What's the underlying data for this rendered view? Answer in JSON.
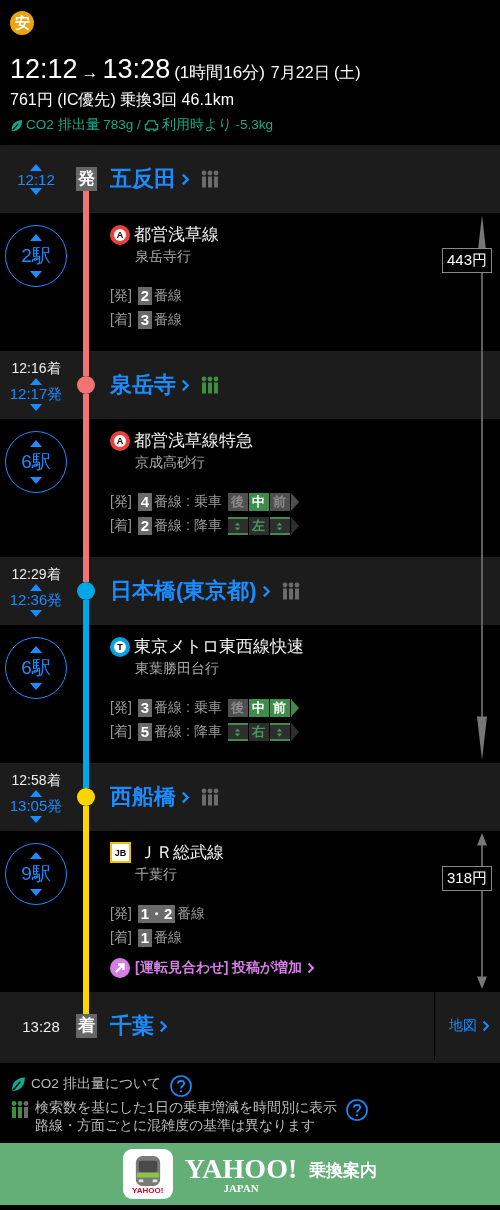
{
  "header": {
    "safety_badge": "安",
    "departure": "12:12",
    "arrow": "→",
    "arrival": "13:28",
    "duration": "(1時間16分)",
    "date": "7月22日 (土)",
    "summary": "761円 (IC優先) 乗換3回 46.1km",
    "co2": "CO2 排出量 783g /",
    "co2_compare": "利用時より -5.3kg"
  },
  "route": [
    {
      "kind": "station",
      "name": "五反田",
      "departure": "12:12",
      "mark": "発",
      "crowd": {
        "color": "#6b6b6b"
      }
    },
    {
      "kind": "leg",
      "color": "#f07474",
      "stops": "2駅",
      "badge": {
        "kind": "circle",
        "text": "A",
        "color": "#e8413c"
      },
      "line": "都営浅草線",
      "destination": "泉岳寺行",
      "fare": "443円",
      "platforms": [
        {
          "tag": "[発]",
          "track": "2",
          "suffix": "番線"
        },
        {
          "tag": "[着]",
          "track": "3",
          "suffix": "番線"
        }
      ]
    },
    {
      "kind": "station",
      "name": "泉岳寺",
      "arrival": "12:16着",
      "departure": "12:17発",
      "crowd": {
        "color": "#3e8e3e"
      }
    },
    {
      "kind": "leg",
      "color": "#f07474",
      "stops": "6駅",
      "badge": {
        "kind": "circle",
        "text": "A",
        "color": "#e8413c"
      },
      "line": "都営浅草線特急",
      "destination": "京成高砂行",
      "platforms": [
        {
          "tag": "[発]",
          "track": "4",
          "suffix": "番線 : 乗車",
          "cars": [
            {
              "label": "後",
              "selected": false
            },
            {
              "label": "中",
              "selected": true
            },
            {
              "label": "前",
              "selected": false
            }
          ]
        },
        {
          "tag": "[着]",
          "track": "2",
          "suffix": "番線 : 降車",
          "doors": [
            {
              "kind": "stairs"
            },
            {
              "kind": "text",
              "label": "左"
            },
            {
              "kind": "stairs"
            }
          ]
        }
      ]
    },
    {
      "kind": "station",
      "name": "日本橋(東京都)",
      "arrival": "12:29着",
      "departure": "12:36発",
      "crowd": {
        "color": "#6b6b6b"
      }
    },
    {
      "kind": "leg",
      "color": "#00a7e8",
      "stops": "6駅",
      "badge": {
        "kind": "circle",
        "text": "T",
        "color": "#0aa0e0"
      },
      "line": "東京メトロ東西線快速",
      "destination": "東葉勝田台行",
      "platforms": [
        {
          "tag": "[発]",
          "track": "3",
          "suffix": "番線 : 乗車",
          "cars": [
            {
              "label": "後",
              "selected": false
            },
            {
              "label": "中",
              "selected": true
            },
            {
              "label": "前",
              "selected": true
            }
          ]
        },
        {
          "tag": "[着]",
          "track": "5",
          "suffix": "番線 : 降車",
          "doors": [
            {
              "kind": "stairs"
            },
            {
              "kind": "text",
              "label": "右"
            },
            {
              "kind": "stairs"
            }
          ]
        }
      ]
    },
    {
      "kind": "station",
      "name": "西船橋",
      "arrival": "12:58着",
      "departure": "13:05発",
      "crowd": {
        "color": "#6b6b6b"
      }
    },
    {
      "kind": "leg",
      "color": "#ffd500",
      "stops": "9駅",
      "badge": {
        "kind": "square",
        "text": "JB",
        "color": "#f2c200"
      },
      "line": "ＪＲ総武線",
      "destination": "千葉行",
      "fare": "318円",
      "platforms": [
        {
          "tag": "[発]",
          "track": "1・2",
          "suffix": "番線"
        },
        {
          "tag": "[着]",
          "track": "1",
          "suffix": "番線"
        }
      ],
      "notice": "[運転見合わせ] 投稿が増加"
    },
    {
      "kind": "station",
      "name": "千葉",
      "arrival": "13:28",
      "mark": "着",
      "map_link": "地図"
    }
  ],
  "notes": [
    {
      "kind": "co2",
      "lines": [
        "CO2 排出量について"
      ]
    },
    {
      "kind": "crowd",
      "lines": [
        "検索数を基にした1日の乗車増減を時間別に表示",
        "路線・方面ごとに混雑度の基準は異なります"
      ]
    }
  ],
  "banner": {
    "app_icon_text": "YAHOO!",
    "brand": "YAHOO!",
    "brand_sub": "JAPAN",
    "service": "乗換案内"
  }
}
